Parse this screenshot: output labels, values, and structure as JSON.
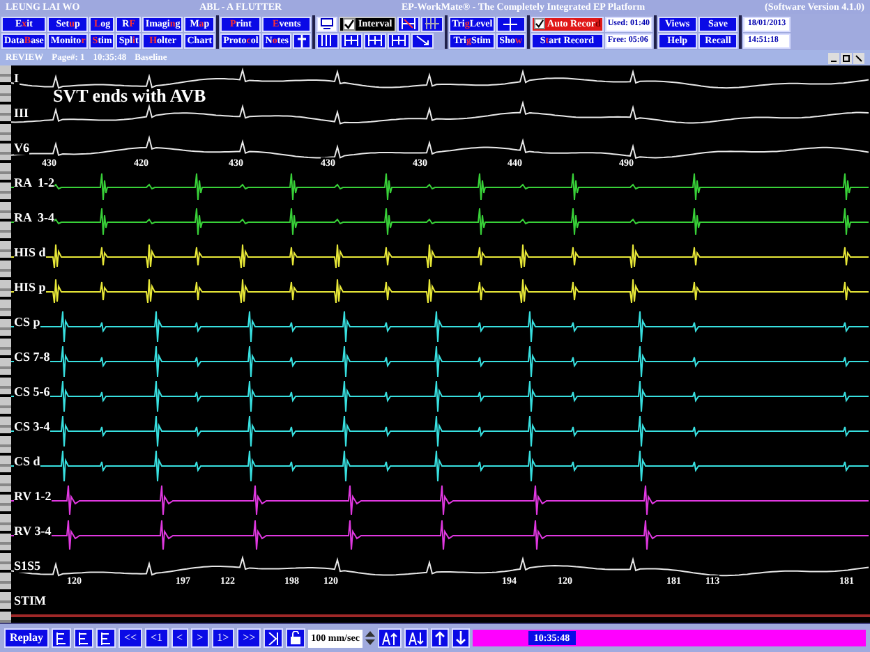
{
  "title_bar": {
    "patient": "LEUNG LAI WO",
    "procedure": "ABL  -  A FLUTTER",
    "application": "EP-WorkMate®  -  The Completely Integrated EP Platform",
    "version": "(Software Version 4.1.0)"
  },
  "menu": [
    [
      {
        "pre": "E",
        "key": "x",
        "post": "it"
      },
      {
        "pre": "Set",
        "key": "u",
        "post": "p"
      },
      {
        "key": "L",
        "post": "og"
      },
      {
        "pre": "R",
        "key": "F"
      },
      {
        "pre": "Imagi",
        "key": "n",
        "post": "g"
      },
      {
        "pre": "M",
        "key": "a",
        "post": "p"
      }
    ],
    [
      {
        "pre": "Data",
        "key": "B",
        "post": "ase"
      },
      {
        "pre": "Monito",
        "key": "r"
      },
      {
        "key": "S",
        "post": "tim"
      },
      {
        "pre": "Spl",
        "key": "i",
        "post": "t"
      },
      {
        "key": "H",
        "post": "olter"
      },
      {
        "pre": "Chart"
      }
    ]
  ],
  "print_group": [
    [
      {
        "key": "P",
        "post": "rint"
      },
      {
        "key": "E",
        "post": "vents"
      }
    ],
    [
      {
        "pre": "Proto",
        "key": "c",
        "post": "ol"
      },
      {
        "pre": "N",
        "key": "o",
        "post": "tes"
      }
    ]
  ],
  "interval": {
    "label": "Interval",
    "checked": true
  },
  "trigger": [
    {
      "pre": "Tri",
      "key": "g",
      "post": "Level"
    },
    {
      "pre": "Tri",
      "key": "g",
      "post": "Stim"
    },
    {
      "pre": "Sho",
      "key": "w"
    }
  ],
  "record": {
    "auto": {
      "pre": "Auto Recor",
      "key": "d",
      "checked": true
    },
    "start": {
      "pre": "S",
      "key": "t",
      "post": "art Record"
    },
    "used": "Used: 01:40",
    "free": "Free: 05:06"
  },
  "actions": [
    [
      "Views",
      "Save"
    ],
    [
      "Help",
      "Recall"
    ]
  ],
  "date": "18/01/2013",
  "time": "14:51:18",
  "review_bar": {
    "mode": "REVIEW",
    "page": "Page#: 1",
    "time": "10:35:48",
    "state": "Baseline"
  },
  "annotation": "SVT ends with AVB",
  "channels": [
    {
      "label": "I",
      "kind": "surface",
      "color": "#e8e8e8"
    },
    {
      "label": "III",
      "kind": "surface",
      "color": "#e8e8e8"
    },
    {
      "label": "V6",
      "kind": "surface",
      "color": "#e8e8e8",
      "intervals": [
        "430",
        "420",
        "430",
        "430",
        "430",
        "440",
        "490"
      ]
    },
    {
      "label": "RA  1-2",
      "kind": "atrial",
      "color": "#38d038"
    },
    {
      "label": "RA  3-4",
      "kind": "atrial",
      "color": "#38d038"
    },
    {
      "label": "HIS d",
      "kind": "his",
      "color": "#e8e838"
    },
    {
      "label": "HIS p",
      "kind": "his",
      "color": "#e8e838"
    },
    {
      "label": "CS p",
      "kind": "cs",
      "color": "#38e0e0"
    },
    {
      "label": "CS 7-8",
      "kind": "cs",
      "color": "#38e0e0"
    },
    {
      "label": "CS 5-6",
      "kind": "cs",
      "color": "#38e0e0"
    },
    {
      "label": "CS 3-4",
      "kind": "cs",
      "color": "#38e0e0"
    },
    {
      "label": "CS d",
      "kind": "cs",
      "color": "#38e0e0"
    },
    {
      "label": "RV 1-2",
      "kind": "rv",
      "color": "#e038e0"
    },
    {
      "label": "RV 3-4",
      "kind": "rv",
      "color": "#e038e0"
    },
    {
      "label": "S1S5",
      "kind": "surface",
      "color": "#e8e8e8",
      "intervals": [
        "120",
        "197",
        "122",
        "198",
        "120",
        "194",
        "120",
        "181",
        "113",
        "181"
      ]
    },
    {
      "label": "STIM",
      "kind": "stim",
      "color": "#a02828"
    }
  ],
  "bottom_bar": {
    "replay": "Replay",
    "nav": [
      "<<",
      "<1",
      "<",
      ">",
      "1>",
      ">>"
    ],
    "speed": "100 mm/sec",
    "time": "10:35:48"
  }
}
